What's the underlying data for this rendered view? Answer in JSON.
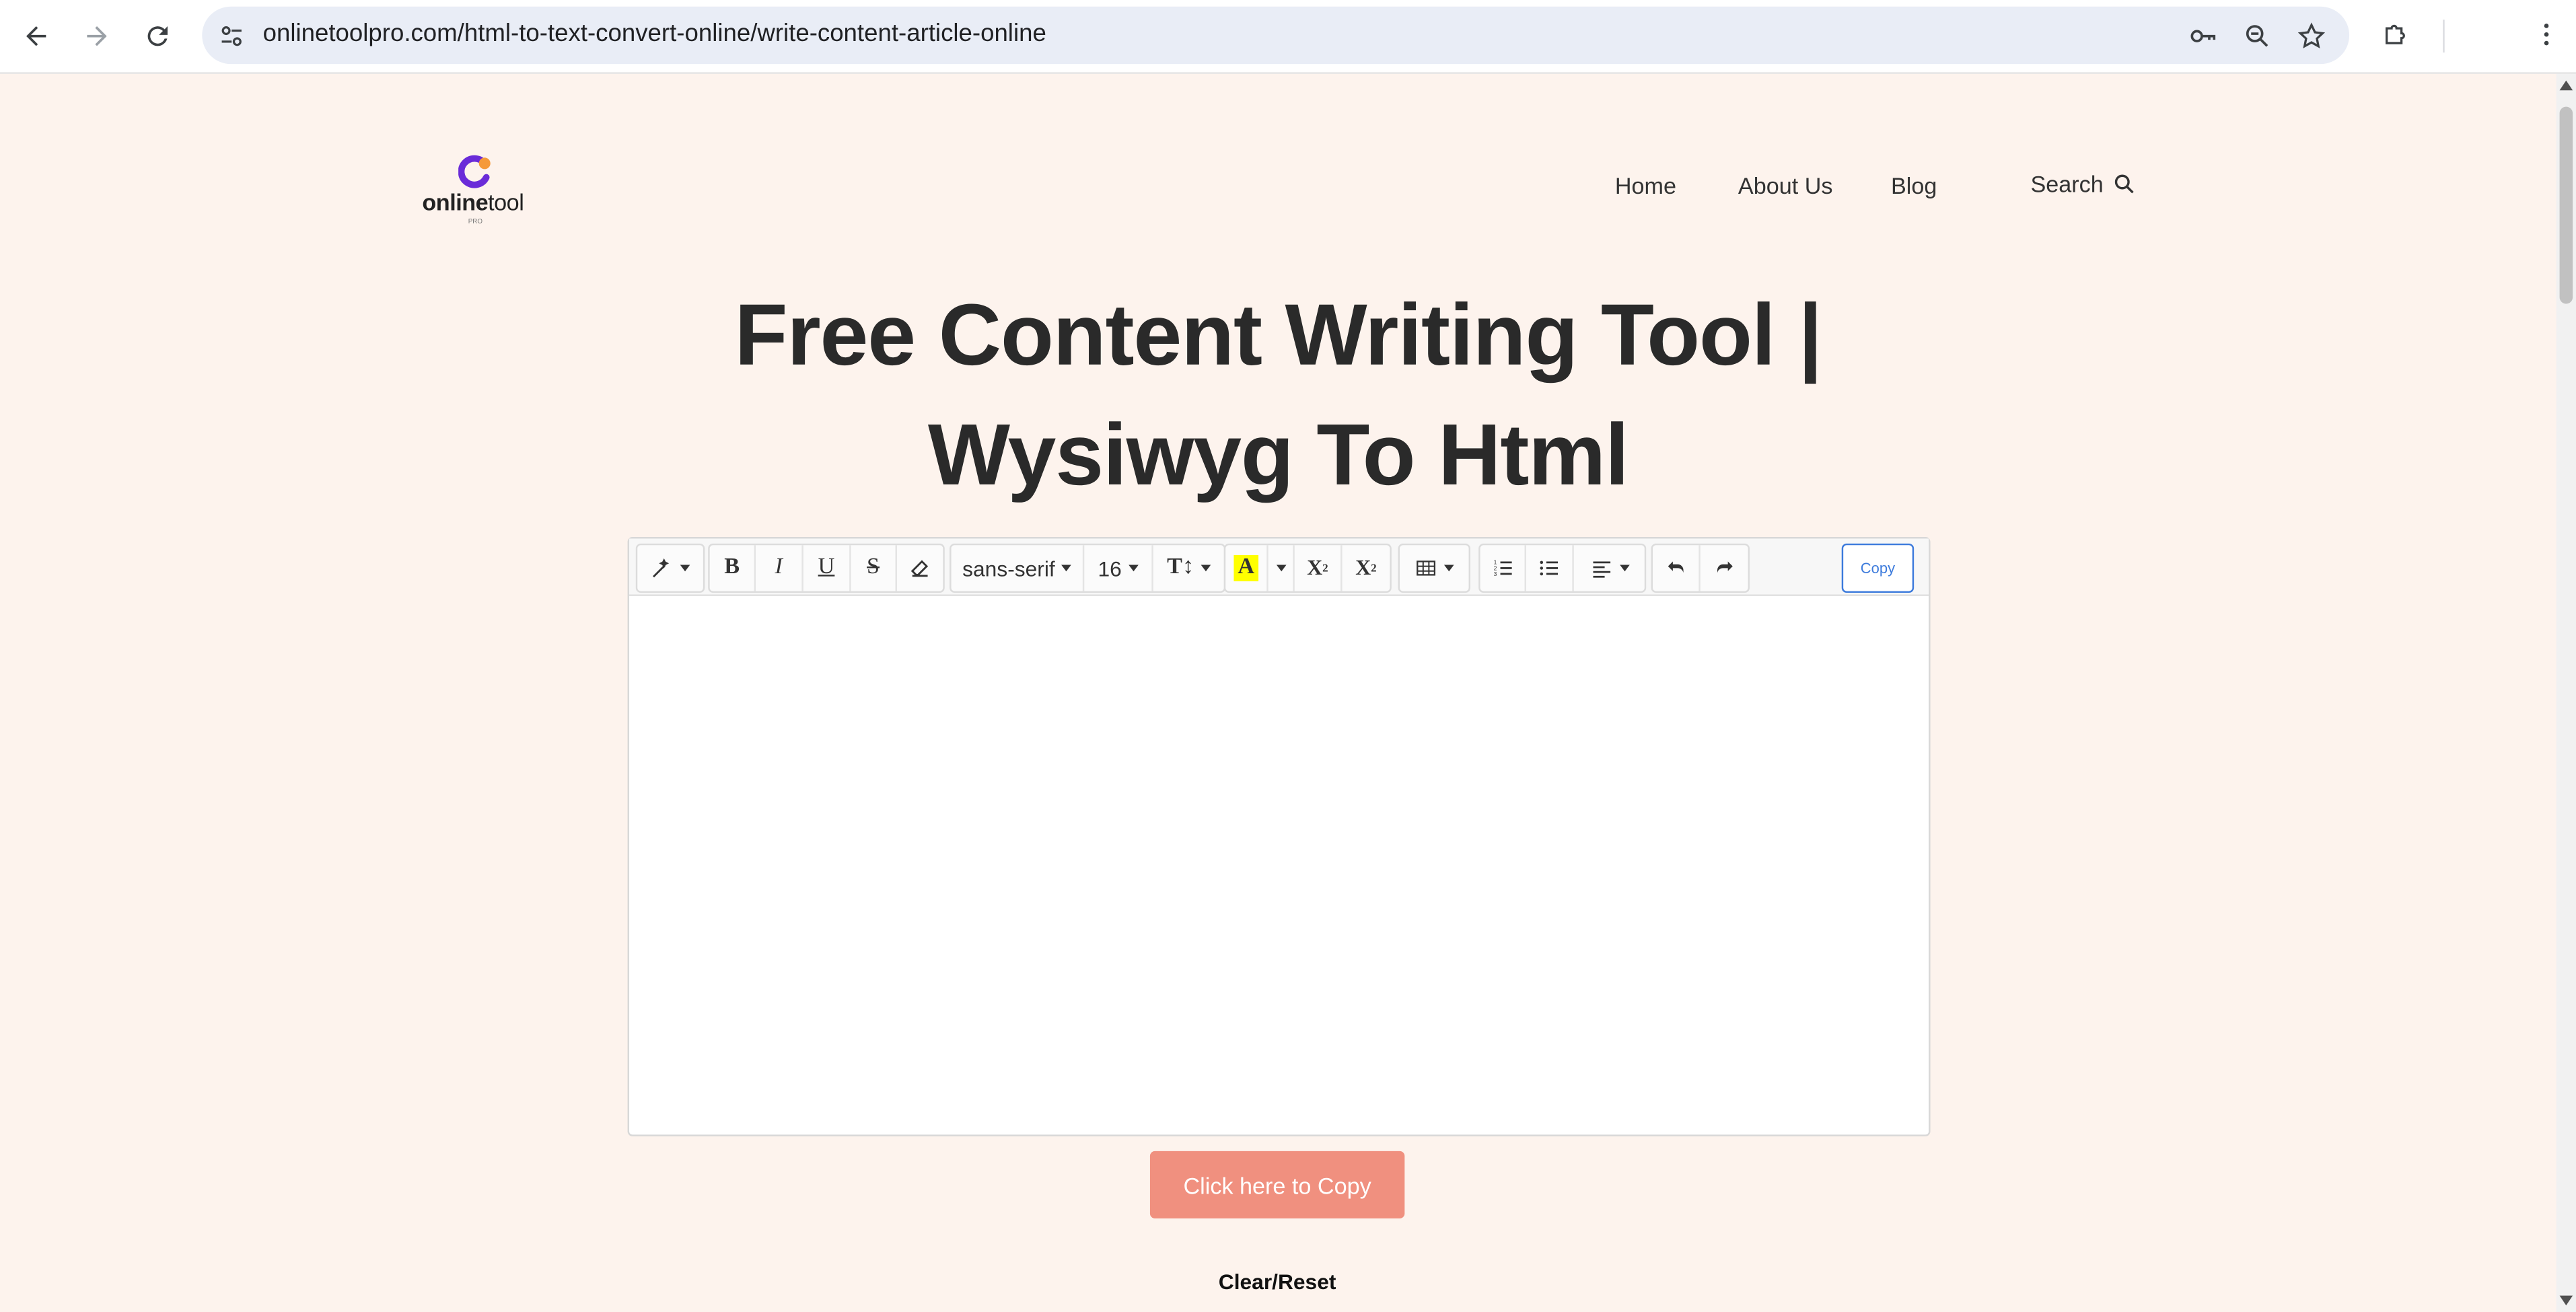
{
  "browser": {
    "url": "onlinetoolpro.com/html-to-text-convert-online/write-content-article-online",
    "icons": {
      "back": "back-arrow-icon",
      "forward": "forward-arrow-icon",
      "reload": "reload-icon",
      "site_info": "tune-icon",
      "password": "key-icon",
      "zoom": "zoom-icon",
      "bookmark": "star-icon",
      "extensions": "puzzle-icon",
      "menu": "kebab-menu-icon"
    }
  },
  "site": {
    "logo": {
      "brand_bold": "online",
      "brand_light": "tool",
      "tagline": "PRO"
    },
    "nav": {
      "home": "Home",
      "about": "About Us",
      "blog": "Blog",
      "search": "Search"
    },
    "title_line1": "Free Content Writing Tool |",
    "title_line2": "Wysiwyg To Html"
  },
  "editor": {
    "font_family": "sans-serif",
    "font_size": "16",
    "copy_label": "Copy",
    "content": ""
  },
  "actions": {
    "copy_button": "Click here to Copy",
    "reset_link": "Clear/Reset"
  },
  "colors": {
    "page_bg": "#fdf3ed",
    "accent_button": "#f0907f",
    "copy_outline": "#3d7bdc",
    "logo_purple": "#6a2bd8",
    "logo_orange": "#f59a3a"
  }
}
